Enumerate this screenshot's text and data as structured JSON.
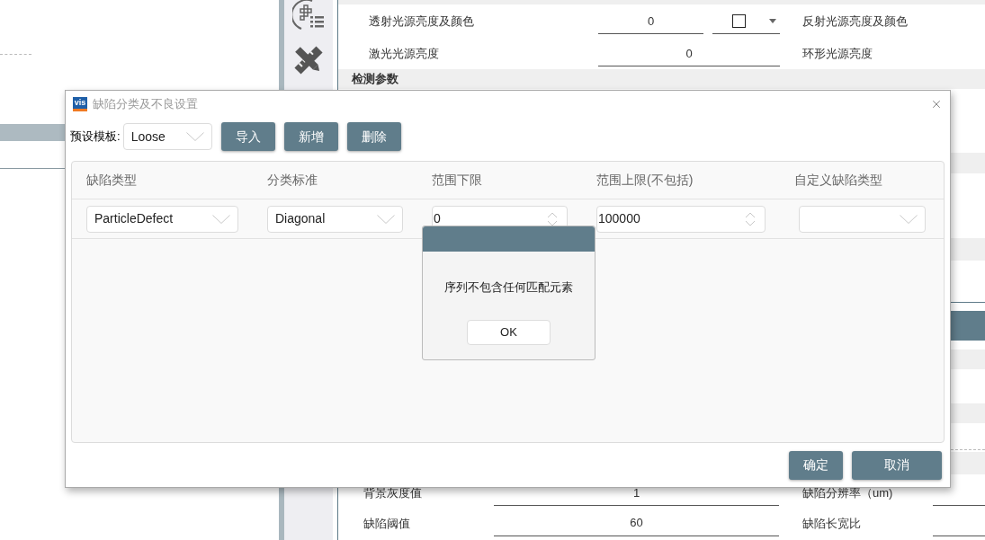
{
  "background": {
    "light_rows": [
      {
        "kind": "color",
        "label": "透射光源亮度及颜色",
        "value": "0",
        "right_label": "反射光源亮度及颜色"
      },
      {
        "kind": "plain",
        "label": "激光光源亮度",
        "value": "0",
        "right_label": "环形光源亮度"
      }
    ],
    "section_header": "检测参数",
    "detect_rows": [
      {
        "label": "背景灰度值",
        "value": "1",
        "right_label": "缺陷分辨率（um)"
      },
      {
        "label": "缺陷阈值",
        "value": "60",
        "right_label": "缺陷长宽比"
      }
    ]
  },
  "dialog": {
    "logo_text": "vis",
    "title": "缺陷分类及不良设置",
    "preset_label": "预设模板:",
    "preset_value": "Loose",
    "toolbar_buttons": [
      "导入",
      "新增",
      "删除"
    ],
    "table": {
      "columns": [
        "缺陷类型",
        "分类标准",
        "范围下限",
        "范围上限(不包括)",
        "自定义缺陷类型"
      ],
      "rows": [
        {
          "cells": [
            {
              "kind": "select",
              "value": "ParticleDefect"
            },
            {
              "kind": "select",
              "value": "Diagonal"
            },
            {
              "kind": "spin",
              "value": "0"
            },
            {
              "kind": "spin",
              "value": "100000"
            },
            {
              "kind": "select"
            }
          ]
        }
      ]
    },
    "footer_buttons": [
      "确定",
      "取消"
    ]
  },
  "message_box": {
    "text": "序列不包含任何匹配元素",
    "button": "OK"
  }
}
